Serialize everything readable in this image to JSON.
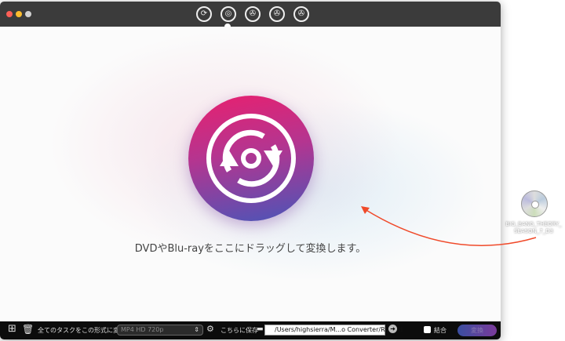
{
  "toolbar": {
    "tabs": [
      {
        "icon": "convert-icon"
      },
      {
        "icon": "dvd-rip-icon"
      },
      {
        "icon": "film-reel-icon"
      },
      {
        "icon": "film-edit-icon"
      },
      {
        "icon": "film-download-icon"
      }
    ],
    "active_tab": 1
  },
  "main": {
    "drop_hint": "DVDやBlu-rayをここにドラッグして変換します。"
  },
  "bottom": {
    "convert_all_label": "全てのタスクをこの形式に変換",
    "format_value": "MP4 HD 720p",
    "save_to_label": "こちらに保存",
    "save_path": "/Users/highsierra/M...o Converter/Ripped",
    "merge_label": "結合",
    "merge_checked": false,
    "convert_button": "変換"
  },
  "desktop": {
    "dvd_file_label": "BIG_BANG_THEORY_SEASON_7_D3"
  },
  "colors": {
    "titlebar": "#3b3b3b",
    "accent_pink": "#e8206f",
    "accent_blue": "#4a55b8",
    "arrow": "#f04a2a"
  }
}
